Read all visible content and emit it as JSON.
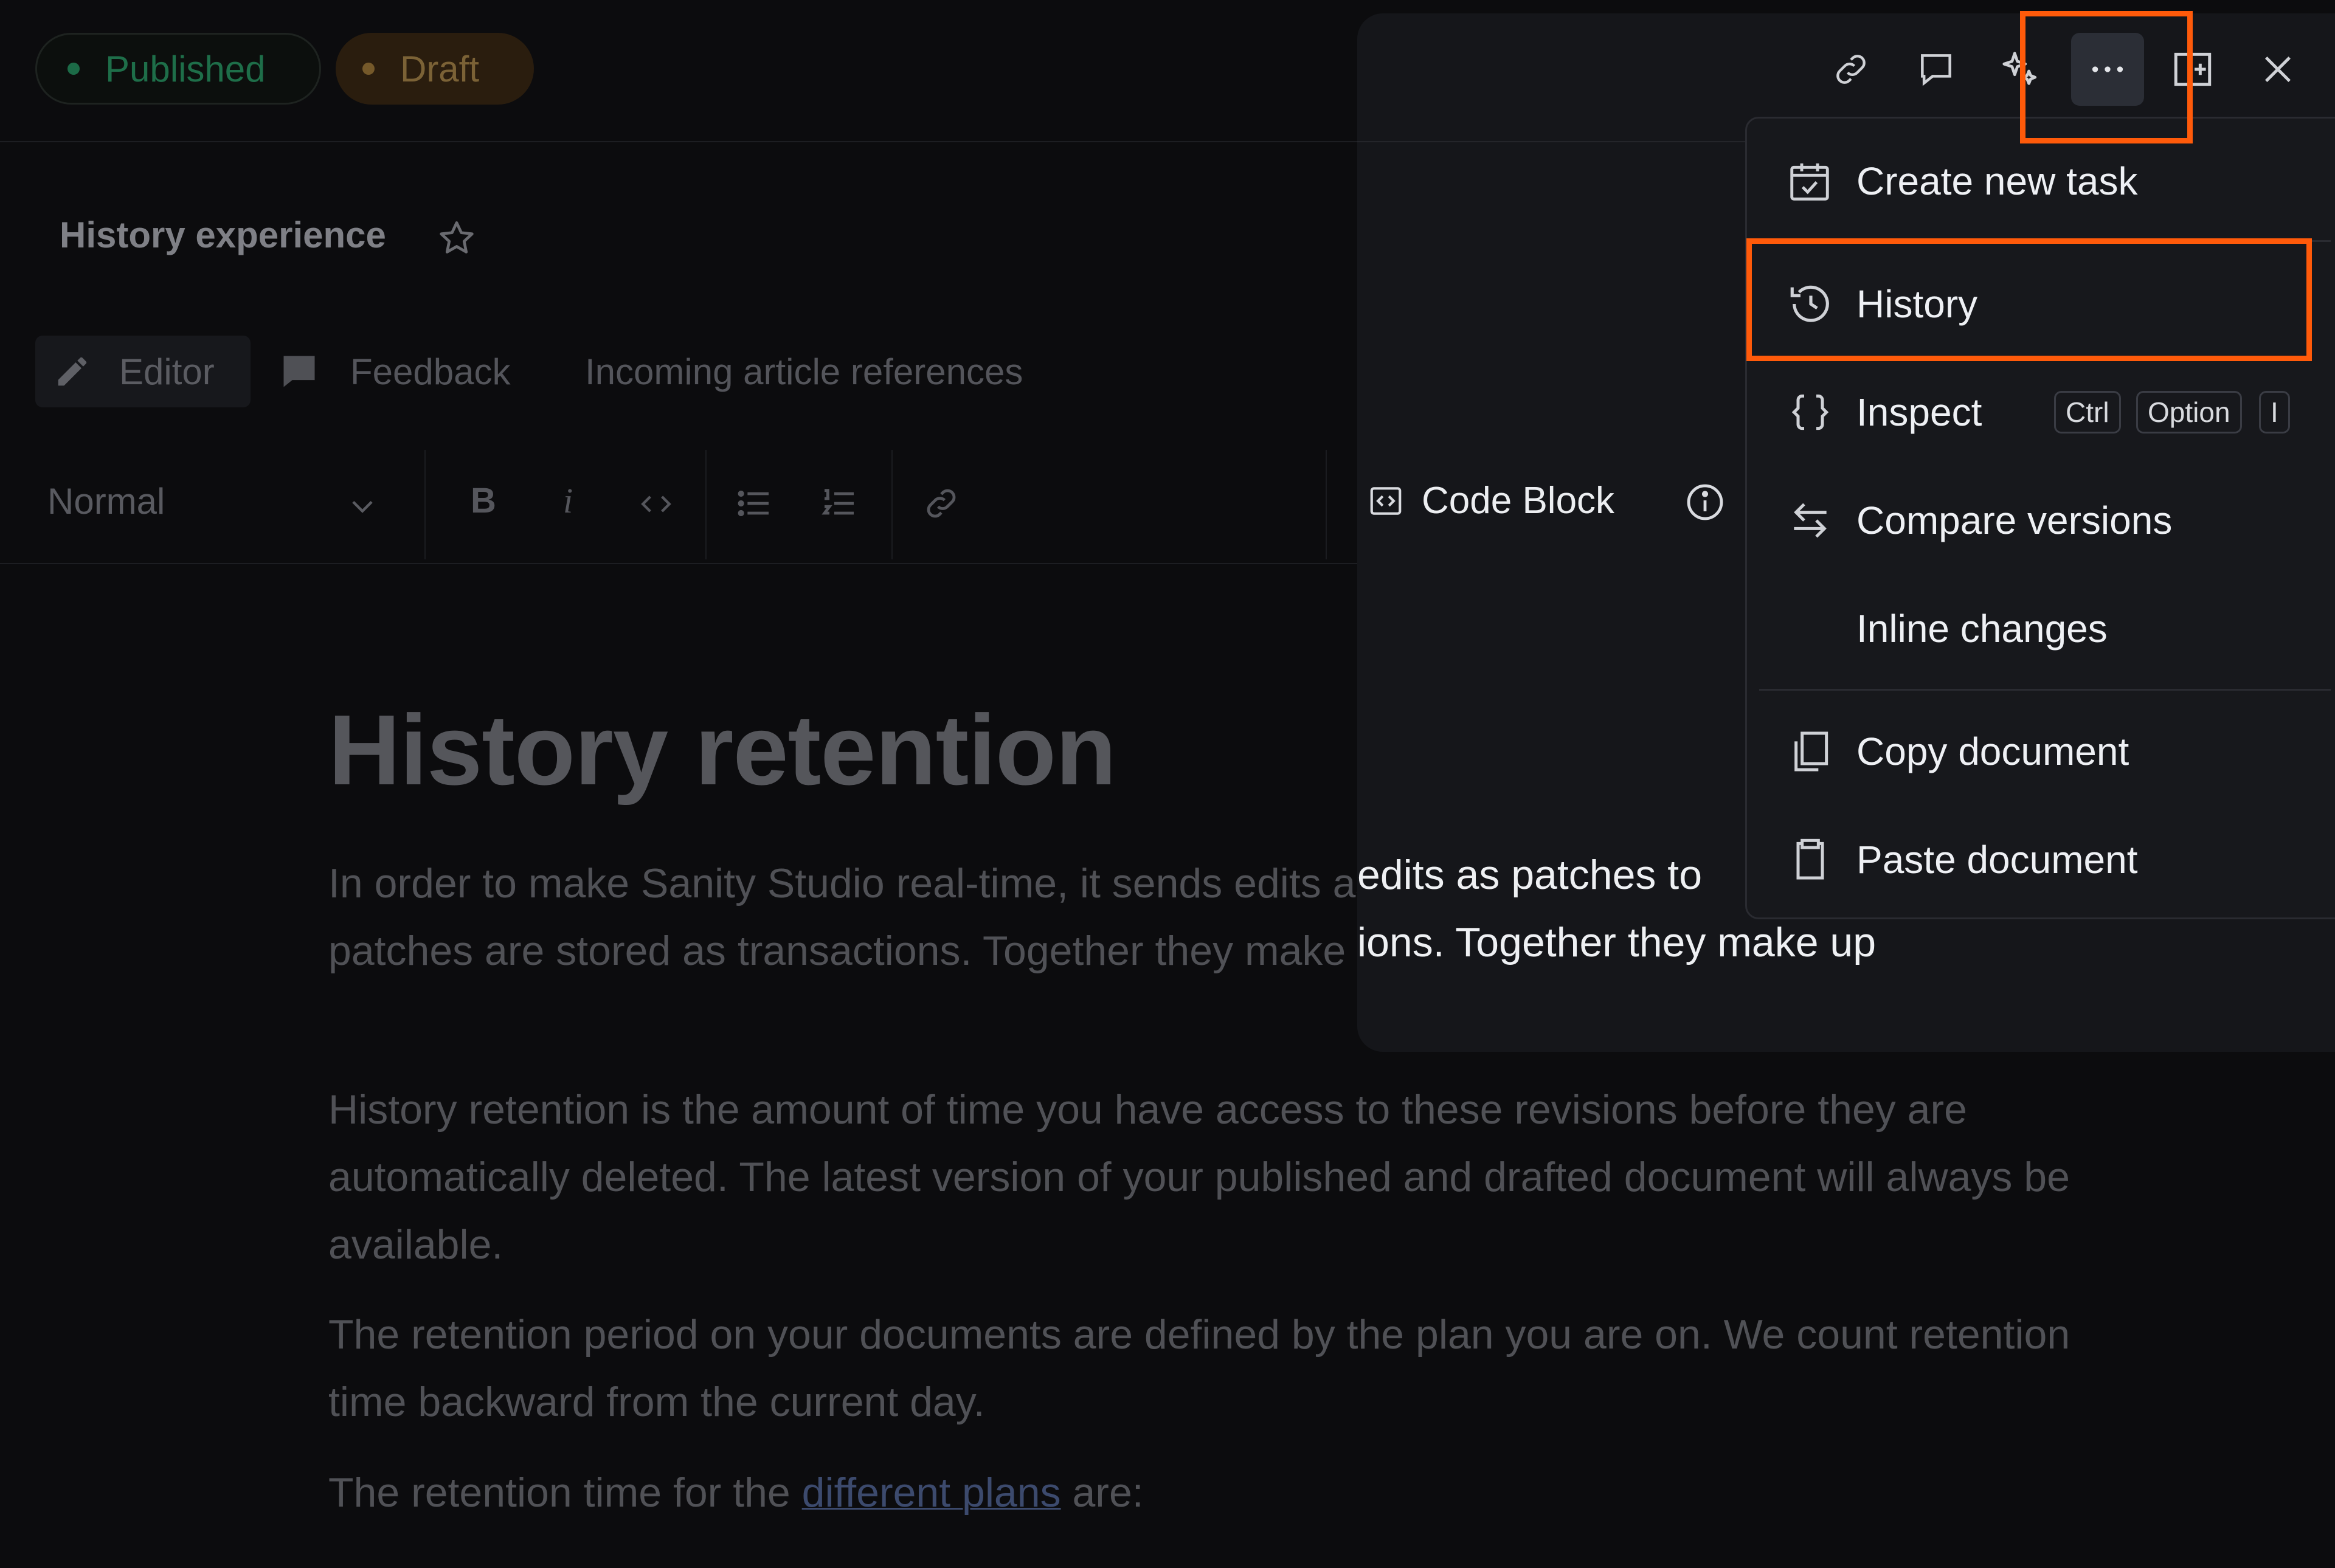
{
  "status": {
    "published": "Published",
    "draft": "Draft"
  },
  "document": {
    "title": "History experience"
  },
  "tabs": {
    "editor": "Editor",
    "feedback": "Feedback",
    "references": "Incoming article references"
  },
  "toolbar": {
    "style": "Normal",
    "bold": "B",
    "italic": "i",
    "code_block": "Code Block"
  },
  "article": {
    "title": "History retention",
    "p1": "In order to make Sanity Studio real-time, it sends edits as patches to the backend. All these patches are stored as transactions. Together they make up your documents’ revision history.",
    "p2": "History retention is the amount of time you have access to these revisions before they are automatically deleted. The latest version of your published and drafted document will always be available.",
    "p3": "The retention period on your documents are defined by the plan you are on. We count retention time backward from the current day.",
    "p4_prefix": "The retention time for the",
    "p4_link": "different plans",
    "p4_suffix": "are:"
  },
  "pane_bleed": {
    "line1": "edits as patches to",
    "line2": "ions. Together they make up"
  },
  "menu": {
    "create_task": "Create new task",
    "history": "History",
    "inspect": "Inspect",
    "inspect_keys": [
      "Ctrl",
      "Option",
      "I"
    ],
    "compare_versions": "Compare versions",
    "inline_changes": "Inline changes",
    "copy_document": "Copy document",
    "paste_document": "Paste document"
  },
  "colors": {
    "annotation": "#ff5a0a",
    "published": "#1c6b47",
    "draft": "#75592a"
  }
}
